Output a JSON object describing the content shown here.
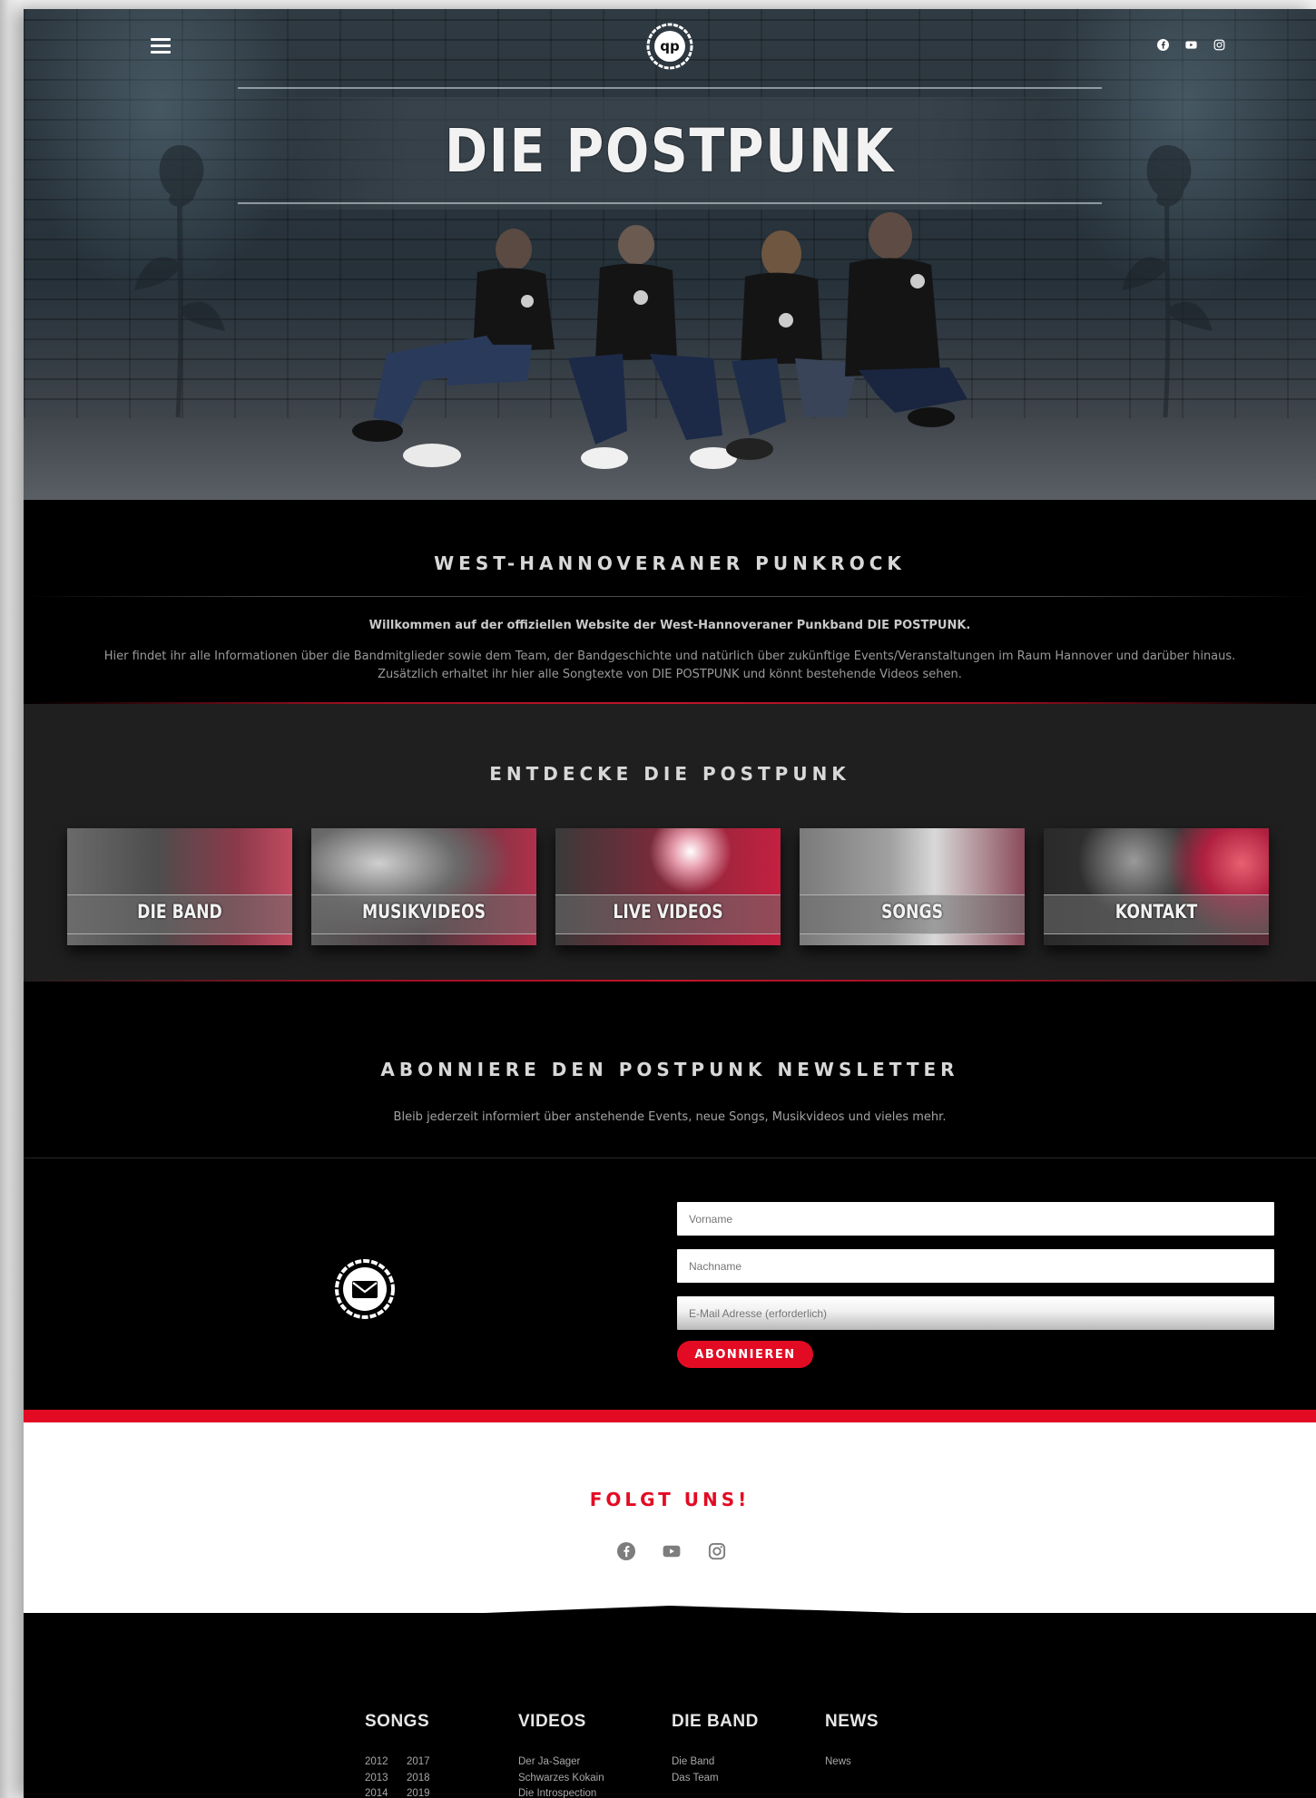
{
  "header": {
    "band_name": "DIE POSTPUNK",
    "logo_text": "qp",
    "social_icons": [
      "facebook-icon",
      "youtube-icon",
      "instagram-icon"
    ]
  },
  "intro": {
    "title": "WEST-HANNOVERANER PUNKROCK",
    "lead": "Willkommen auf der offiziellen Website der West-Hannoveraner Punkband DIE POSTPUNK.",
    "body_line1": "Hier findet ihr alle Informationen über die Bandmitglieder sowie dem Team, der Bandgeschichte und natürlich über zukünftige Events/Veranstaltungen im Raum Hannover und darüber hinaus.",
    "body_line2": "Zusätzlich erhaltet ihr hier alle Songtexte von DIE POSTPUNK und könnt bestehende Videos sehen."
  },
  "discover": {
    "title": "ENTDECKE DIE POSTPUNK",
    "cards": [
      "DIE BAND",
      "MUSIKVIDEOS",
      "LIVE VIDEOS",
      "SONGS",
      "KONTAKT"
    ]
  },
  "newsletter": {
    "title": "ABONNIERE DEN POSTPUNK NEWSLETTER",
    "text": "Bleib jederzeit informiert über anstehende Events, neue Songs, Musikvideos und vieles mehr.",
    "first_name_placeholder": "Vorname",
    "last_name_placeholder": "Nachname",
    "email_placeholder": "E-Mail Adresse (erforderlich)",
    "button": "ABONNIEREN"
  },
  "follow": {
    "title": "FOLGT UNS!",
    "social_icons": [
      "facebook-icon",
      "youtube-icon",
      "instagram-icon"
    ]
  },
  "footer": {
    "songs": {
      "title": "SONGS",
      "years": [
        "2012",
        "2017",
        "2013",
        "2018",
        "2014",
        "2019"
      ]
    },
    "videos": {
      "title": "VIDEOS",
      "items": [
        "Der Ja-Sager",
        "Schwarzes Kokain",
        "Die Introspection"
      ]
    },
    "band": {
      "title": "DIE BAND",
      "items": [
        "Die Band",
        "Das Team"
      ]
    },
    "news": {
      "title": "NEWS",
      "items": [
        "News"
      ]
    }
  },
  "colors": {
    "accent_red": "#e30b23",
    "dark_section": "#1f1f1f",
    "black": "#000000"
  }
}
